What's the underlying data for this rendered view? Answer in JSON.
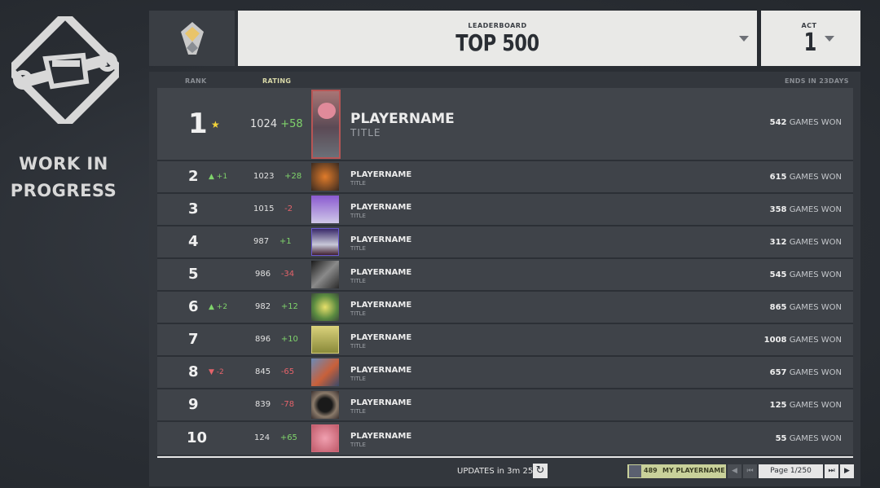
{
  "wip": {
    "line1": "WORK IN",
    "line2": "PROGRESS"
  },
  "header": {
    "leaderboard_label": "LEADERBOARD",
    "leaderboard_value": "TOP 500",
    "act_label": "ACT",
    "act_value": "1"
  },
  "columns": {
    "rank": "RANK",
    "rating": "RATING",
    "ends": "ENDS IN 23DAYS"
  },
  "rows": [
    {
      "rank": "1",
      "change": "",
      "change_dir": "star",
      "rating": "1024",
      "delta": "+58",
      "name": "PLAYERNAME",
      "title": "TITLE",
      "games_num": "542",
      "games_label": "GAMES WON"
    },
    {
      "rank": "2",
      "change": "+1",
      "change_dir": "up",
      "rating": "1023",
      "delta": "+28",
      "name": "PLAYERNAME",
      "title": "TITLE",
      "games_num": "615",
      "games_label": "GAMES WON"
    },
    {
      "rank": "3",
      "change": "",
      "change_dir": "none",
      "rating": "1015",
      "delta": "-2",
      "name": "PLAYERNAME",
      "title": "TITLE",
      "games_num": "358",
      "games_label": "GAMES WON"
    },
    {
      "rank": "4",
      "change": "",
      "change_dir": "none",
      "rating": "987",
      "delta": "+1",
      "name": "PLAYERNAME",
      "title": "TITLE",
      "games_num": "312",
      "games_label": "GAMES WON"
    },
    {
      "rank": "5",
      "change": "",
      "change_dir": "none",
      "rating": "986",
      "delta": "-34",
      "name": "PLAYERNAME",
      "title": "TITLE",
      "games_num": "545",
      "games_label": "GAMES WON"
    },
    {
      "rank": "6",
      "change": "+2",
      "change_dir": "up",
      "rating": "982",
      "delta": "+12",
      "name": "PLAYERNAME",
      "title": "TITLE",
      "games_num": "865",
      "games_label": "GAMES WON"
    },
    {
      "rank": "7",
      "change": "",
      "change_dir": "none",
      "rating": "896",
      "delta": "+10",
      "name": "PLAYERNAME",
      "title": "TITLE",
      "games_num": "1008",
      "games_label": "GAMES WON"
    },
    {
      "rank": "8",
      "change": "-2",
      "change_dir": "down",
      "rating": "845",
      "delta": "-65",
      "name": "PLAYERNAME",
      "title": "TITLE",
      "games_num": "657",
      "games_label": "GAMES WON"
    },
    {
      "rank": "9",
      "change": "",
      "change_dir": "none",
      "rating": "839",
      "delta": "-78",
      "name": "PLAYERNAME",
      "title": "TITLE",
      "games_num": "125",
      "games_label": "GAMES WON"
    },
    {
      "rank": "10",
      "change": "",
      "change_dir": "none",
      "rating": "124",
      "delta": "+65",
      "name": "PLAYERNAME",
      "title": "TITLE",
      "games_num": "55",
      "games_label": "GAMES WON"
    }
  ],
  "footer": {
    "updates": "UPDATES in 3m 25s",
    "my_rank": "489",
    "my_name": "MY PLAYERNAME",
    "page": "Page 1/250"
  },
  "colors": {
    "positive": "#7fd36b",
    "negative": "#e4636a",
    "accent": "#c9d19a"
  }
}
